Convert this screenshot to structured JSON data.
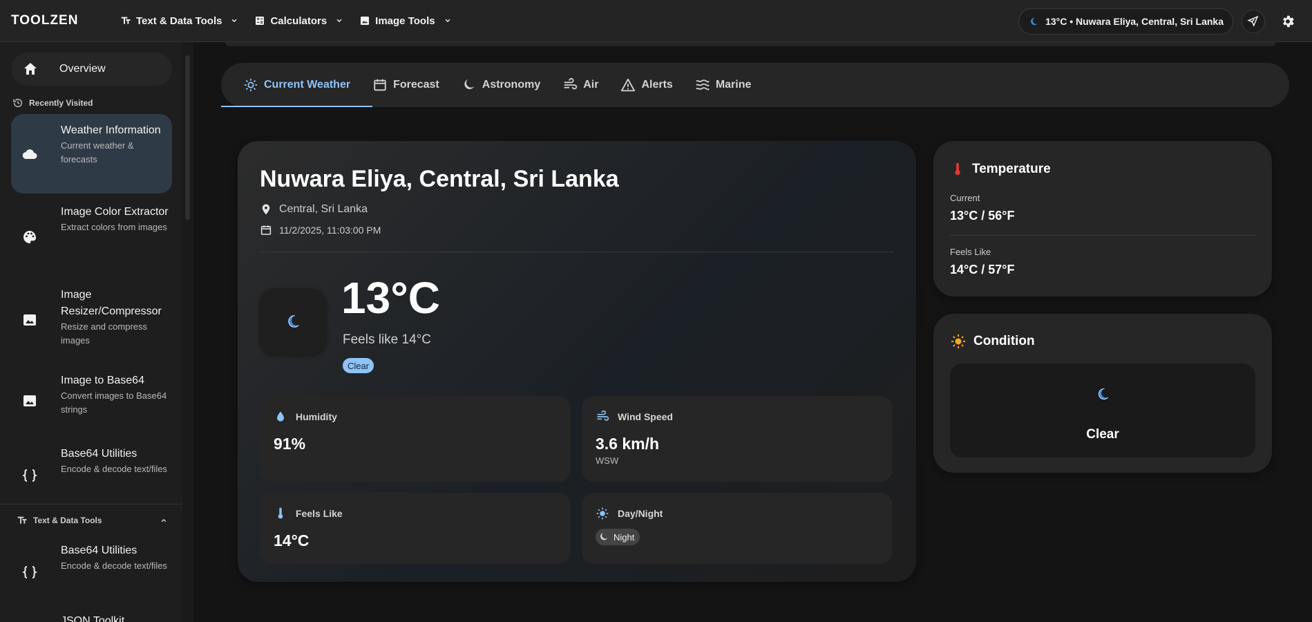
{
  "brand": "TOOLZEN",
  "topnav": [
    {
      "label": "Text & Data Tools"
    },
    {
      "label": "Calculators"
    },
    {
      "label": "Image Tools"
    }
  ],
  "weather_chip": "13°C • Nuwara Eliya, Central, Sri Lanka",
  "sidebar": {
    "overview": "Overview",
    "recent_title": "Recently Visited",
    "recent": [
      {
        "title": "Weather Information",
        "desc": "Current weather & forecasts"
      },
      {
        "title": "Image Color Extractor",
        "desc": "Extract colors from images"
      },
      {
        "title": "Image Resizer/Compressor",
        "desc": "Resize and compress images"
      },
      {
        "title": "Image to Base64",
        "desc": "Convert images to Base64 strings"
      },
      {
        "title": "Base64 Utilities",
        "desc": "Encode & decode text/files"
      }
    ],
    "section2_title": "Text & Data Tools",
    "section2": [
      {
        "title": "Base64 Utilities",
        "desc": "Encode & decode text/files"
      },
      {
        "title": "JSON Toolkit",
        "desc": ""
      }
    ]
  },
  "tabs": [
    "Current Weather",
    "Forecast",
    "Astronomy",
    "Air",
    "Alerts",
    "Marine"
  ],
  "current": {
    "location": "Nuwara Eliya, Central, Sri Lanka",
    "region": "Central, Sri Lanka",
    "datetime": "11/2/2025, 11:03:00 PM",
    "temp": "13°C",
    "feels": "Feels like 14°C",
    "condition": "Clear",
    "stats": {
      "humidity_label": "Humidity",
      "humidity": "91%",
      "wind_label": "Wind Speed",
      "wind": "3.6 km/h",
      "wind_dir": "WSW",
      "feels_label": "Feels Like",
      "feels": "14°C",
      "daynight_label": "Day/Night",
      "daynight": "Night"
    }
  },
  "temperature_card": {
    "title": "Temperature",
    "current_label": "Current",
    "current": "13°C / 56°F",
    "feels_label": "Feels Like",
    "feels": "14°C / 57°F"
  },
  "condition_card": {
    "title": "Condition",
    "text": "Clear"
  },
  "colors": {
    "accent": "#8fc3f7",
    "moon": "#3a8be0",
    "thermometer_red": "#e53935",
    "sun_orange": "#f5a623"
  }
}
